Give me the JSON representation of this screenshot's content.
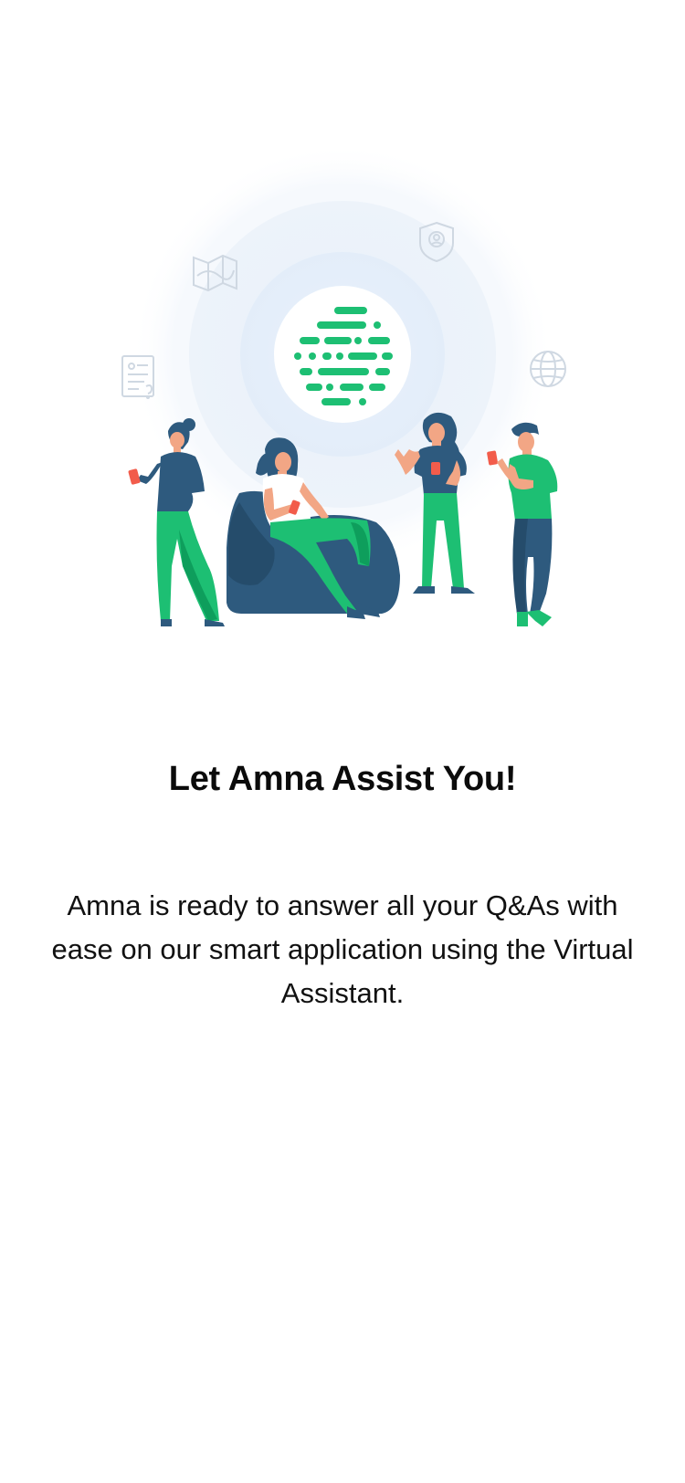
{
  "onboarding": {
    "title": "Let Amna Assist You!",
    "description": "Amna is ready to answer all your Q&As with ease on our smart application using the Virtual Assistant."
  },
  "illustration": {
    "center_logo": "amna-logo-icon",
    "floating_icons": [
      "map-icon",
      "shield-user-icon",
      "id-card-question-icon",
      "globe-icon"
    ],
    "people": [
      "person-standing-left",
      "person-on-beanbag",
      "person-standing-center",
      "person-standing-right"
    ]
  },
  "colors": {
    "accent_green": "#1DBF73",
    "navy": "#2E5A7E",
    "halo_blue": "#E8F1FB"
  }
}
